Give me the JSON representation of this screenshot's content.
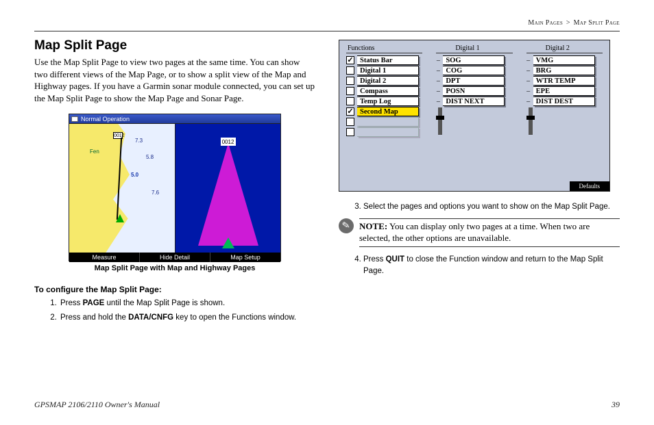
{
  "breadcrumb": {
    "section": "Main Pages",
    "sep": ">",
    "page": "Map Split Page"
  },
  "heading": "Map Split Page",
  "intro": "Use the Map Split Page to view two pages at the same time. You can show two different views of the Map Page, or to show a split view of the Map and Highway pages. If you have a Garmin sonar module connected, you can set up the Map Split Page to show the Map Page and Sonar Page.",
  "figure": {
    "titlebar": "Normal Operation",
    "waypoint": "0012",
    "bottom": {
      "a": "Measure",
      "b": "Hide Detail",
      "c": "Map Setup"
    },
    "caption": "Map Split Page with Map and Highway Pages"
  },
  "subhead": "To configure the Map Split Page:",
  "steps_left": [
    {
      "pre": "Press ",
      "bold": "PAGE",
      "post": " until the Map Split Page is shown."
    },
    {
      "pre": "Press and hold the ",
      "bold": "DATA/CNFG",
      "post": " key to open the Functions window."
    }
  ],
  "func": {
    "headers": {
      "a": "Functions",
      "b": "Digital 1",
      "c": "Digital 2"
    },
    "colA": [
      {
        "label": "Status Bar",
        "checked": true
      },
      {
        "label": "Digital 1",
        "checked": false
      },
      {
        "label": "Digital 2",
        "checked": false
      },
      {
        "label": "Compass",
        "checked": false
      },
      {
        "label": "Temp Log",
        "checked": false
      },
      {
        "label": "Second Map",
        "checked": true,
        "selected": true
      },
      {
        "label": "",
        "disabled": true
      },
      {
        "label": "",
        "disabled": true
      }
    ],
    "colB": [
      "SOG",
      "COG",
      "DPT",
      "POSN",
      "DIST NEXT"
    ],
    "colC": [
      "VMG",
      "BRG",
      "WTR TEMP",
      "EPE",
      "DIST DEST"
    ],
    "footer": "Defaults"
  },
  "steps_right": [
    {
      "n": "3",
      "pre": "Select the pages and options you want to show on the Map Split Page.",
      "bold": "",
      "post": ""
    },
    {
      "n": "4",
      "pre": "Press ",
      "bold": "QUIT",
      "post": " to close the Function window and return to the Map Split Page."
    }
  ],
  "note": {
    "label": "NOTE:",
    "text": " You can display only two pages at a time. When two are selected, the other options are unavailable."
  },
  "footer": {
    "left": "GPSMAP 2106/2110 Owner's Manual",
    "right": "39"
  }
}
